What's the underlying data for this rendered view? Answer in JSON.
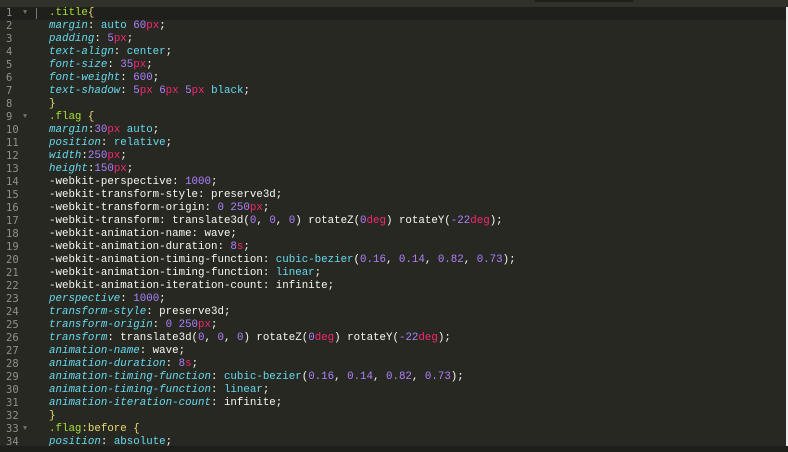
{
  "editor": {
    "language": "CSS",
    "colors": {
      "background": "#272822",
      "property": "#66d9ef",
      "number": "#ae81ff",
      "unit": "#f92672",
      "selector": "#a6e22e",
      "text": "#f8f8f2"
    },
    "fold_icon": "fold-triangle-icon",
    "lines": [
      {
        "n": "1",
        "fold": true,
        "current": true,
        "t": [
          [
            "s",
            ".title"
          ],
          [
            "y",
            "{"
          ]
        ]
      },
      {
        "n": "2",
        "t": [
          [
            "p",
            "margin"
          ],
          [
            "w",
            ": "
          ],
          [
            "k",
            "auto "
          ],
          [
            "n",
            "60"
          ],
          [
            "u",
            "px"
          ],
          [
            "w",
            ";"
          ]
        ]
      },
      {
        "n": "3",
        "t": [
          [
            "p",
            "padding"
          ],
          [
            "w",
            ": "
          ],
          [
            "n",
            "5"
          ],
          [
            "u",
            "px"
          ],
          [
            "w",
            ";"
          ]
        ]
      },
      {
        "n": "4",
        "t": [
          [
            "p",
            "text-align"
          ],
          [
            "w",
            ": "
          ],
          [
            "k",
            "center"
          ],
          [
            "w",
            ";"
          ]
        ]
      },
      {
        "n": "5",
        "t": [
          [
            "p",
            "font-size"
          ],
          [
            "w",
            ": "
          ],
          [
            "n",
            "35"
          ],
          [
            "u",
            "px"
          ],
          [
            "w",
            ";"
          ]
        ]
      },
      {
        "n": "6",
        "t": [
          [
            "p",
            "font-weight"
          ],
          [
            "w",
            ": "
          ],
          [
            "n",
            "600"
          ],
          [
            "w",
            ";"
          ]
        ]
      },
      {
        "n": "7",
        "t": [
          [
            "p",
            "text-shadow"
          ],
          [
            "w",
            ": "
          ],
          [
            "n",
            "5"
          ],
          [
            "u",
            "px "
          ],
          [
            "n",
            "6"
          ],
          [
            "u",
            "px "
          ],
          [
            "n",
            "5"
          ],
          [
            "u",
            "px "
          ],
          [
            "k",
            "black"
          ],
          [
            "w",
            ";"
          ]
        ]
      },
      {
        "n": "8",
        "t": [
          [
            "y",
            "}"
          ]
        ]
      },
      {
        "n": "9",
        "fold": true,
        "t": [
          [
            "s",
            ".flag "
          ],
          [
            "y",
            "{"
          ]
        ]
      },
      {
        "n": "10",
        "t": [
          [
            "p",
            "margin"
          ],
          [
            "w",
            ":"
          ],
          [
            "n",
            "30"
          ],
          [
            "u",
            "px "
          ],
          [
            "k",
            "auto"
          ],
          [
            "w",
            ";"
          ]
        ]
      },
      {
        "n": "11",
        "t": [
          [
            "p",
            "position"
          ],
          [
            "w",
            ": "
          ],
          [
            "k",
            "relative"
          ],
          [
            "w",
            ";"
          ]
        ]
      },
      {
        "n": "12",
        "t": [
          [
            "p",
            "width"
          ],
          [
            "w",
            ":"
          ],
          [
            "n",
            "250"
          ],
          [
            "u",
            "px"
          ],
          [
            "w",
            ";"
          ]
        ]
      },
      {
        "n": "13",
        "t": [
          [
            "p",
            "height"
          ],
          [
            "w",
            ":"
          ],
          [
            "n",
            "150"
          ],
          [
            "u",
            "px"
          ],
          [
            "w",
            ";"
          ]
        ]
      },
      {
        "n": "14",
        "t": [
          [
            "w",
            "-webkit-perspective: "
          ],
          [
            "n",
            "1000"
          ],
          [
            "w",
            ";"
          ]
        ]
      },
      {
        "n": "15",
        "t": [
          [
            "w",
            "-webkit-transform-style: preserve3d;"
          ]
        ]
      },
      {
        "n": "16",
        "t": [
          [
            "w",
            "-webkit-transform-origin: "
          ],
          [
            "n",
            "0 250"
          ],
          [
            "u",
            "px"
          ],
          [
            "w",
            ";"
          ]
        ]
      },
      {
        "n": "17",
        "t": [
          [
            "w",
            "-webkit-transform: translate3d("
          ],
          [
            "n",
            "0"
          ],
          [
            "w",
            ", "
          ],
          [
            "n",
            "0"
          ],
          [
            "w",
            ", "
          ],
          [
            "n",
            "0"
          ],
          [
            "w",
            ") rotateZ("
          ],
          [
            "n",
            "0"
          ],
          [
            "u",
            "deg"
          ],
          [
            "w",
            ") rotateY("
          ],
          [
            "n",
            "-22"
          ],
          [
            "u",
            "deg"
          ],
          [
            "w",
            ");"
          ]
        ]
      },
      {
        "n": "18",
        "t": [
          [
            "w",
            "-webkit-animation-name: wave;"
          ]
        ]
      },
      {
        "n": "19",
        "t": [
          [
            "w",
            "-webkit-animation-duration: "
          ],
          [
            "n",
            "8"
          ],
          [
            "u",
            "s"
          ],
          [
            "w",
            ";"
          ]
        ]
      },
      {
        "n": "20",
        "t": [
          [
            "w",
            "-webkit-animation-timing-function: "
          ],
          [
            "k",
            "cubic-bezier"
          ],
          [
            "w",
            "("
          ],
          [
            "n",
            "0.16"
          ],
          [
            "w",
            ", "
          ],
          [
            "n",
            "0.14"
          ],
          [
            "w",
            ", "
          ],
          [
            "n",
            "0.82"
          ],
          [
            "w",
            ", "
          ],
          [
            "n",
            "0.73"
          ],
          [
            "w",
            ");"
          ]
        ]
      },
      {
        "n": "21",
        "t": [
          [
            "w",
            "-webkit-animation-timing-function: "
          ],
          [
            "k",
            "linear"
          ],
          [
            "w",
            ";"
          ]
        ]
      },
      {
        "n": "22",
        "t": [
          [
            "w",
            "-webkit-animation-iteration-count: infinite;"
          ]
        ]
      },
      {
        "n": "23",
        "t": [
          [
            "p",
            "perspective"
          ],
          [
            "w",
            ": "
          ],
          [
            "n",
            "1000"
          ],
          [
            "w",
            ";"
          ]
        ]
      },
      {
        "n": "24",
        "t": [
          [
            "p",
            "transform-style"
          ],
          [
            "w",
            ": preserve3d;"
          ]
        ]
      },
      {
        "n": "25",
        "t": [
          [
            "p",
            "transform-origin"
          ],
          [
            "w",
            ": "
          ],
          [
            "n",
            "0 250"
          ],
          [
            "u",
            "px"
          ],
          [
            "w",
            ";"
          ]
        ]
      },
      {
        "n": "26",
        "t": [
          [
            "p",
            "transform"
          ],
          [
            "w",
            ": translate3d("
          ],
          [
            "n",
            "0"
          ],
          [
            "w",
            ", "
          ],
          [
            "n",
            "0"
          ],
          [
            "w",
            ", "
          ],
          [
            "n",
            "0"
          ],
          [
            "w",
            ") rotateZ("
          ],
          [
            "n",
            "0"
          ],
          [
            "u",
            "deg"
          ],
          [
            "w",
            ") rotateY("
          ],
          [
            "n",
            "-22"
          ],
          [
            "u",
            "deg"
          ],
          [
            "w",
            ");"
          ]
        ]
      },
      {
        "n": "27",
        "t": [
          [
            "p",
            "animation-name"
          ],
          [
            "w",
            ": wave;"
          ]
        ]
      },
      {
        "n": "28",
        "t": [
          [
            "p",
            "animation-duration"
          ],
          [
            "w",
            ": "
          ],
          [
            "n",
            "8"
          ],
          [
            "u",
            "s"
          ],
          [
            "w",
            ";"
          ]
        ]
      },
      {
        "n": "29",
        "t": [
          [
            "p",
            "animation-timing-function"
          ],
          [
            "w",
            ": "
          ],
          [
            "k",
            "cubic-bezier"
          ],
          [
            "w",
            "("
          ],
          [
            "n",
            "0.16"
          ],
          [
            "w",
            ", "
          ],
          [
            "n",
            "0.14"
          ],
          [
            "w",
            ", "
          ],
          [
            "n",
            "0.82"
          ],
          [
            "w",
            ", "
          ],
          [
            "n",
            "0.73"
          ],
          [
            "w",
            ");"
          ]
        ]
      },
      {
        "n": "30",
        "t": [
          [
            "p",
            "animation-timing-function"
          ],
          [
            "w",
            ": "
          ],
          [
            "k",
            "linear"
          ],
          [
            "w",
            ";"
          ]
        ]
      },
      {
        "n": "31",
        "t": [
          [
            "p",
            "animation-iteration-count"
          ],
          [
            "w",
            ": infinite;"
          ]
        ]
      },
      {
        "n": "32",
        "t": [
          [
            "y",
            "}"
          ]
        ]
      },
      {
        "n": "33",
        "fold": true,
        "t": [
          [
            "s",
            ".flag"
          ],
          [
            "y",
            ":before "
          ],
          [
            "y",
            "{"
          ]
        ]
      },
      {
        "n": "34",
        "t": [
          [
            "p",
            "position"
          ],
          [
            "w",
            ": "
          ],
          [
            "k",
            "absolute"
          ],
          [
            "w",
            ";"
          ]
        ]
      }
    ]
  }
}
